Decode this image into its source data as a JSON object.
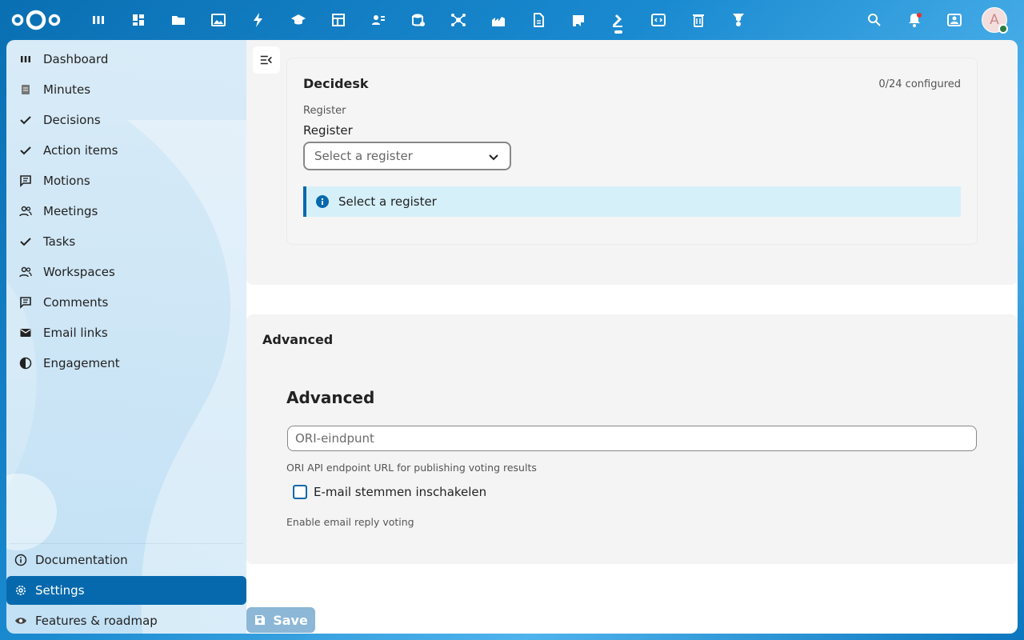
{
  "topbar": {
    "apps": [
      {
        "icon": "dashboard-icon"
      },
      {
        "icon": "grid-icon"
      },
      {
        "icon": "files-icon"
      },
      {
        "icon": "photos-icon"
      },
      {
        "icon": "activity-icon"
      },
      {
        "icon": "learning-icon"
      },
      {
        "icon": "tables-icon"
      },
      {
        "icon": "contacts-icon"
      },
      {
        "icon": "database-icon"
      },
      {
        "icon": "network-icon"
      },
      {
        "icon": "chart-icon"
      },
      {
        "icon": "document-icon"
      },
      {
        "icon": "flag-icon"
      },
      {
        "icon": "gavel-icon",
        "active": true
      },
      {
        "icon": "code-icon"
      },
      {
        "icon": "trash-icon"
      },
      {
        "icon": "settings-cog-icon"
      }
    ],
    "avatar_initial": "A"
  },
  "sidebar": {
    "items": [
      {
        "label": "Dashboard",
        "icon": "dashboard-icon"
      },
      {
        "label": "Minutes",
        "icon": "document-icon"
      },
      {
        "label": "Decisions",
        "icon": "check-icon"
      },
      {
        "label": "Action items",
        "icon": "check-icon"
      },
      {
        "label": "Motions",
        "icon": "comment-icon"
      },
      {
        "label": "Meetings",
        "icon": "people-icon"
      },
      {
        "label": "Tasks",
        "icon": "check-icon"
      },
      {
        "label": "Workspaces",
        "icon": "people-icon"
      },
      {
        "label": "Comments",
        "icon": "comment-icon"
      },
      {
        "label": "Email links",
        "icon": "email-icon"
      },
      {
        "label": "Engagement",
        "icon": "contrast-icon"
      }
    ],
    "bottom": [
      {
        "label": "Documentation",
        "icon": "info-icon"
      },
      {
        "label": "Settings",
        "icon": "gear-icon",
        "active": true
      },
      {
        "label": "Features & roadmap",
        "icon": "eye-icon"
      }
    ]
  },
  "decidesk": {
    "title": "Decidesk",
    "count": "0/24 configured",
    "small_label": "Register",
    "field_label": "Register",
    "select_placeholder": "Select a register",
    "info_text": "Select a register"
  },
  "advanced": {
    "section_heading": "Advanced",
    "title": "Advanced",
    "ori_placeholder": "ORI-eindpunt",
    "ori_help": "ORI API endpoint URL for publishing voting results",
    "email_label": "E-mail stemmen inschakelen",
    "email_help": "Enable email reply voting"
  },
  "save_label": "Save",
  "colors": {
    "primary": "#0769ad",
    "info_bg": "#d6f0f9",
    "save_disabled": "#8cb7d6"
  }
}
